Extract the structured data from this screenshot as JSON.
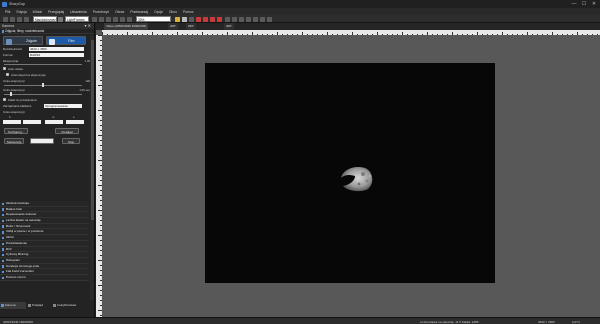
{
  "window": {
    "title": "SharpCap",
    "controls": [
      "—",
      "☐",
      "✕"
    ]
  },
  "menu": [
    "Plik",
    "Edycja",
    "Widok",
    "Przeglądaj",
    "Ustawienia",
    "Przechwyć",
    "Obraz",
    "Przetwarzaj",
    "Opcje",
    "Okno",
    "Pomoc"
  ],
  "toolbar": {
    "camera_field": "Manildobrywer",
    "mode_field": "LightFrames",
    "zoom_field": "33%"
  },
  "left_panel": {
    "header": "Kamera",
    "capture_section": "Zdjęcia, filmy, rozdzielczość",
    "start_button": "Zdjęcie",
    "stop_button": "Film",
    "resolution_label": "Rozdzielczość",
    "resolution_value": "4640 × 3506",
    "format_label": "Format",
    "format_value": "RAW16",
    "exposure_label": "Ekspozycja",
    "exposure_value": "1.00",
    "auto_label": "Auto ustaw",
    "auto_exposure_label": "Automatyczna ekspozycja",
    "gain_label": "Czas ekspozycji",
    "gain_value": "100",
    "shutter_label": "Czas ekspozycji",
    "shutter_value": "1/10 sec",
    "frames_check": "Klatki do przekazania",
    "histogram_label": "Zarządzanie klatkami",
    "histogram_value": "Oprogramowanie",
    "sequence_label": "Czas ekspozycji",
    "seq_labels": [
      "h",
      "",
      "m",
      "s"
    ],
    "btn_configure": "Konfiguruj...",
    "btn_start": "Podgląd",
    "btn_record": "Sekwencja",
    "btn_stop": "Stop",
    "stack_items": [
      "Główna korekcja",
      "Balans bieli",
      "Dopasowanie kolorów",
      "Liczba klatek na sekundę",
      "Bufor / Szumność",
      "Odbij w pionie / w poziomie",
      "Obrót",
      "Przedstawienie",
      "ROI",
      "Cyfrowy Binning",
      "Histogram",
      "Korekcja ciemnego pola",
      "Flat Field Correction",
      "Poziom czerni"
    ],
    "bottom_tabs": [
      "Kamera",
      "Podgląd",
      "Celuj/Rozstaw"
    ]
  },
  "video": {
    "tab_label": "Video (4056X3040 16000X95)",
    "readouts": [
      "200\"",
      "250\"",
      "300\""
    ]
  },
  "status": {
    "left": "4056X3040 16000X95",
    "middle": "Liczba klatek na sekundę: 11.5   Klatka: 2485",
    "right": "4640 × 3506",
    "far_right": "(LiFT)"
  }
}
